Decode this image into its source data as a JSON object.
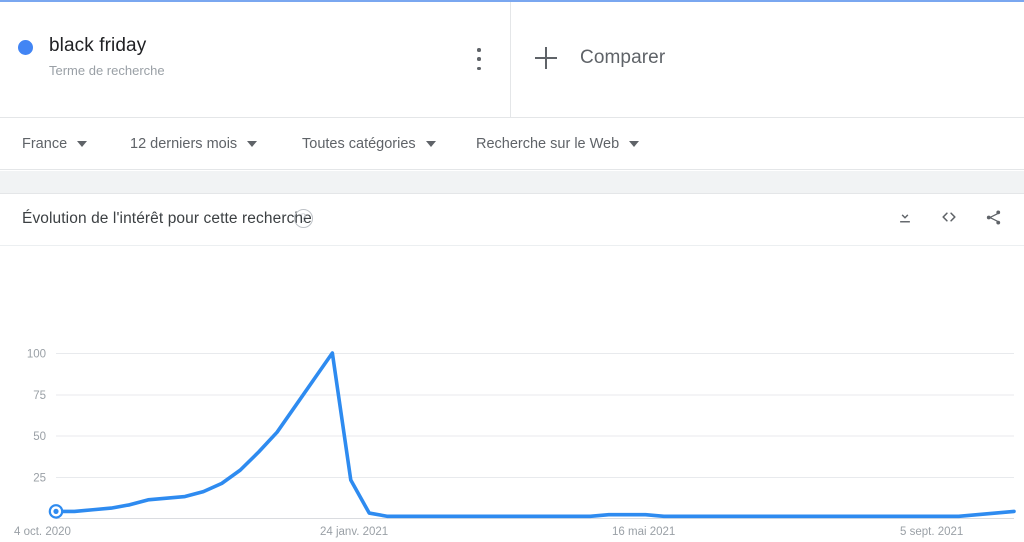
{
  "term_card": {
    "title": "black friday",
    "subtitle": "Terme de recherche",
    "dot_color": "#4285f4",
    "menu_icon": "more-vert-icon"
  },
  "compare_card": {
    "label": "Comparer",
    "plus_icon": "plus-icon"
  },
  "filters": [
    {
      "label": "France",
      "name": "filter-country"
    },
    {
      "label": "12 derniers mois",
      "name": "filter-time-range"
    },
    {
      "label": "Toutes catégories",
      "name": "filter-category"
    },
    {
      "label": "Recherche sur le Web",
      "name": "filter-search-type"
    }
  ],
  "chart_card": {
    "title": "Évolution de l'intérêt pour cette recherche",
    "help_icon": "help-circle-icon",
    "actions": [
      {
        "name": "download-icon",
        "label": "download"
      },
      {
        "name": "embed-code-icon",
        "label": "<>"
      },
      {
        "name": "share-icon",
        "label": "share"
      }
    ]
  },
  "chart_data": {
    "type": "line",
    "title": "Évolution de l'intérêt pour cette recherche",
    "xlabel": "",
    "ylabel": "",
    "ylim": [
      0,
      100
    ],
    "yticks": [
      25,
      50,
      75,
      100
    ],
    "xticks": [
      "4 oct. 2020",
      "24 janv. 2021",
      "16 mai 2021",
      "5 sept. 2021"
    ],
    "grid": true,
    "legend_position": "top-card",
    "line_color": "#2e8bf0",
    "series": [
      {
        "name": "black friday",
        "values": [
          4,
          4,
          5,
          6,
          8,
          11,
          12,
          13,
          16,
          21,
          29,
          40,
          52,
          68,
          84,
          100,
          23,
          3,
          1,
          1,
          1,
          1,
          1,
          1,
          1,
          1,
          1,
          1,
          1,
          1,
          2,
          2,
          2,
          1,
          1,
          1,
          1,
          1,
          1,
          1,
          1,
          1,
          1,
          1,
          1,
          1,
          1,
          1,
          1,
          1,
          2,
          3,
          4
        ]
      }
    ],
    "marker": {
      "index": 0,
      "value": 4,
      "label": "4 oct. 2020"
    }
  }
}
